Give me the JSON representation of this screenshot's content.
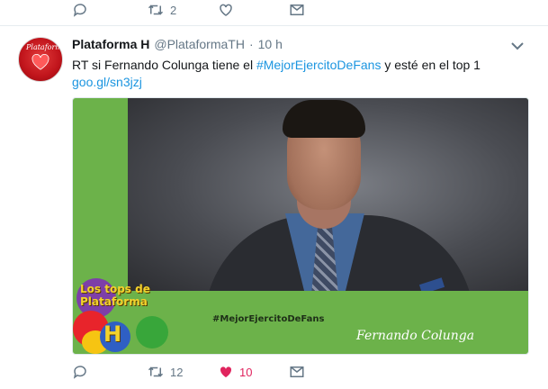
{
  "previous_tweet": {
    "actions": {
      "reply_count": "",
      "retweet_count": "2",
      "like_count": ""
    }
  },
  "tweet": {
    "author_name": "Plataforma H",
    "handle": "@PlataformaTH",
    "separator": "·",
    "time": "10 h",
    "text_prefix": "RT si Fernando Colunga tiene el ",
    "hashtag": "#MejorEjercitoDeFans",
    "text_suffix": " y esté en el top 1",
    "link": "goo.gl/sn3jzj",
    "avatar_text": "Plataforma",
    "media": {
      "logo_line1": "Los tops de",
      "logo_line2": "Plataforma",
      "logo_letter": "H",
      "hashtag_caption": "#MejorEjercitoDeFans",
      "signature": "Fernando Colunga",
      "background_color": "#6cb24a"
    },
    "actions": {
      "reply_count": "",
      "retweet_count": "12",
      "like_count": "10",
      "liked": true
    }
  },
  "colors": {
    "accent": "#1b95e0",
    "like": "#e0245e",
    "muted": "#657786"
  }
}
